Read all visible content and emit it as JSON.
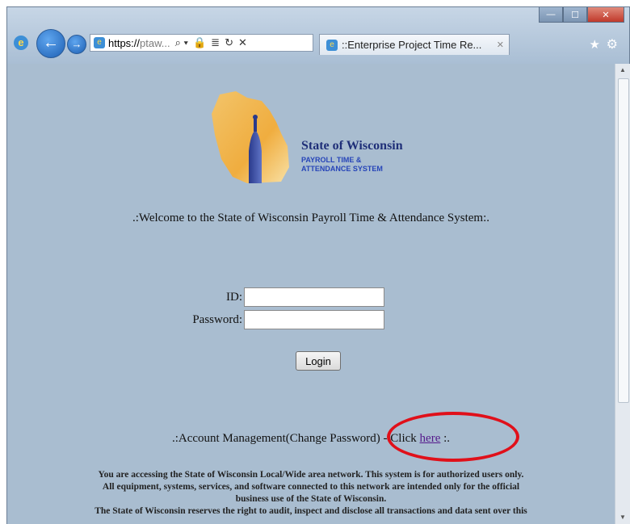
{
  "browser": {
    "url_host": "https://",
    "url_faded": "ptaw...",
    "address_buttons": [
      "⌕ ▾",
      "🔒",
      "≣",
      "↻",
      "✕"
    ],
    "tab_title": "::Enterprise Project Time Re...",
    "window_controls": {
      "minimize": "—",
      "maximize": "☐",
      "close": "✕"
    },
    "icons": {
      "back": "arrow-left-icon",
      "forward": "arrow-right-icon",
      "favorites": "star-icon",
      "tools": "gear-icon"
    }
  },
  "page": {
    "logo": {
      "org": "State of Wisconsin",
      "sub_line1": "PAYROLL TIME &",
      "sub_line2": "ATTENDANCE SYSTEM"
    },
    "welcome": ".:Welcome to the State of Wisconsin Payroll Time & Attendance System:.",
    "form": {
      "id_label": "ID:",
      "id_value": "",
      "password_label": "Password:",
      "password_value": "",
      "login_label": "Login"
    },
    "account": {
      "prefix": ".:Account Management(Change Password) - Click ",
      "link": "here",
      "suffix": " :."
    },
    "notice": [
      "You are accessing the State of Wisconsin Local/Wide area network. This system is for authorized users only.",
      "All equipment, systems, services, and software connected to this network are intended only for the official",
      "business use of the State of Wisconsin.",
      "The State of Wisconsin reserves the right to audit, inspect and disclose all transactions and data sent over this"
    ],
    "colors": {
      "background": "#a9bdd0",
      "highlight": "#e0101a",
      "link": "#551a8b"
    }
  }
}
